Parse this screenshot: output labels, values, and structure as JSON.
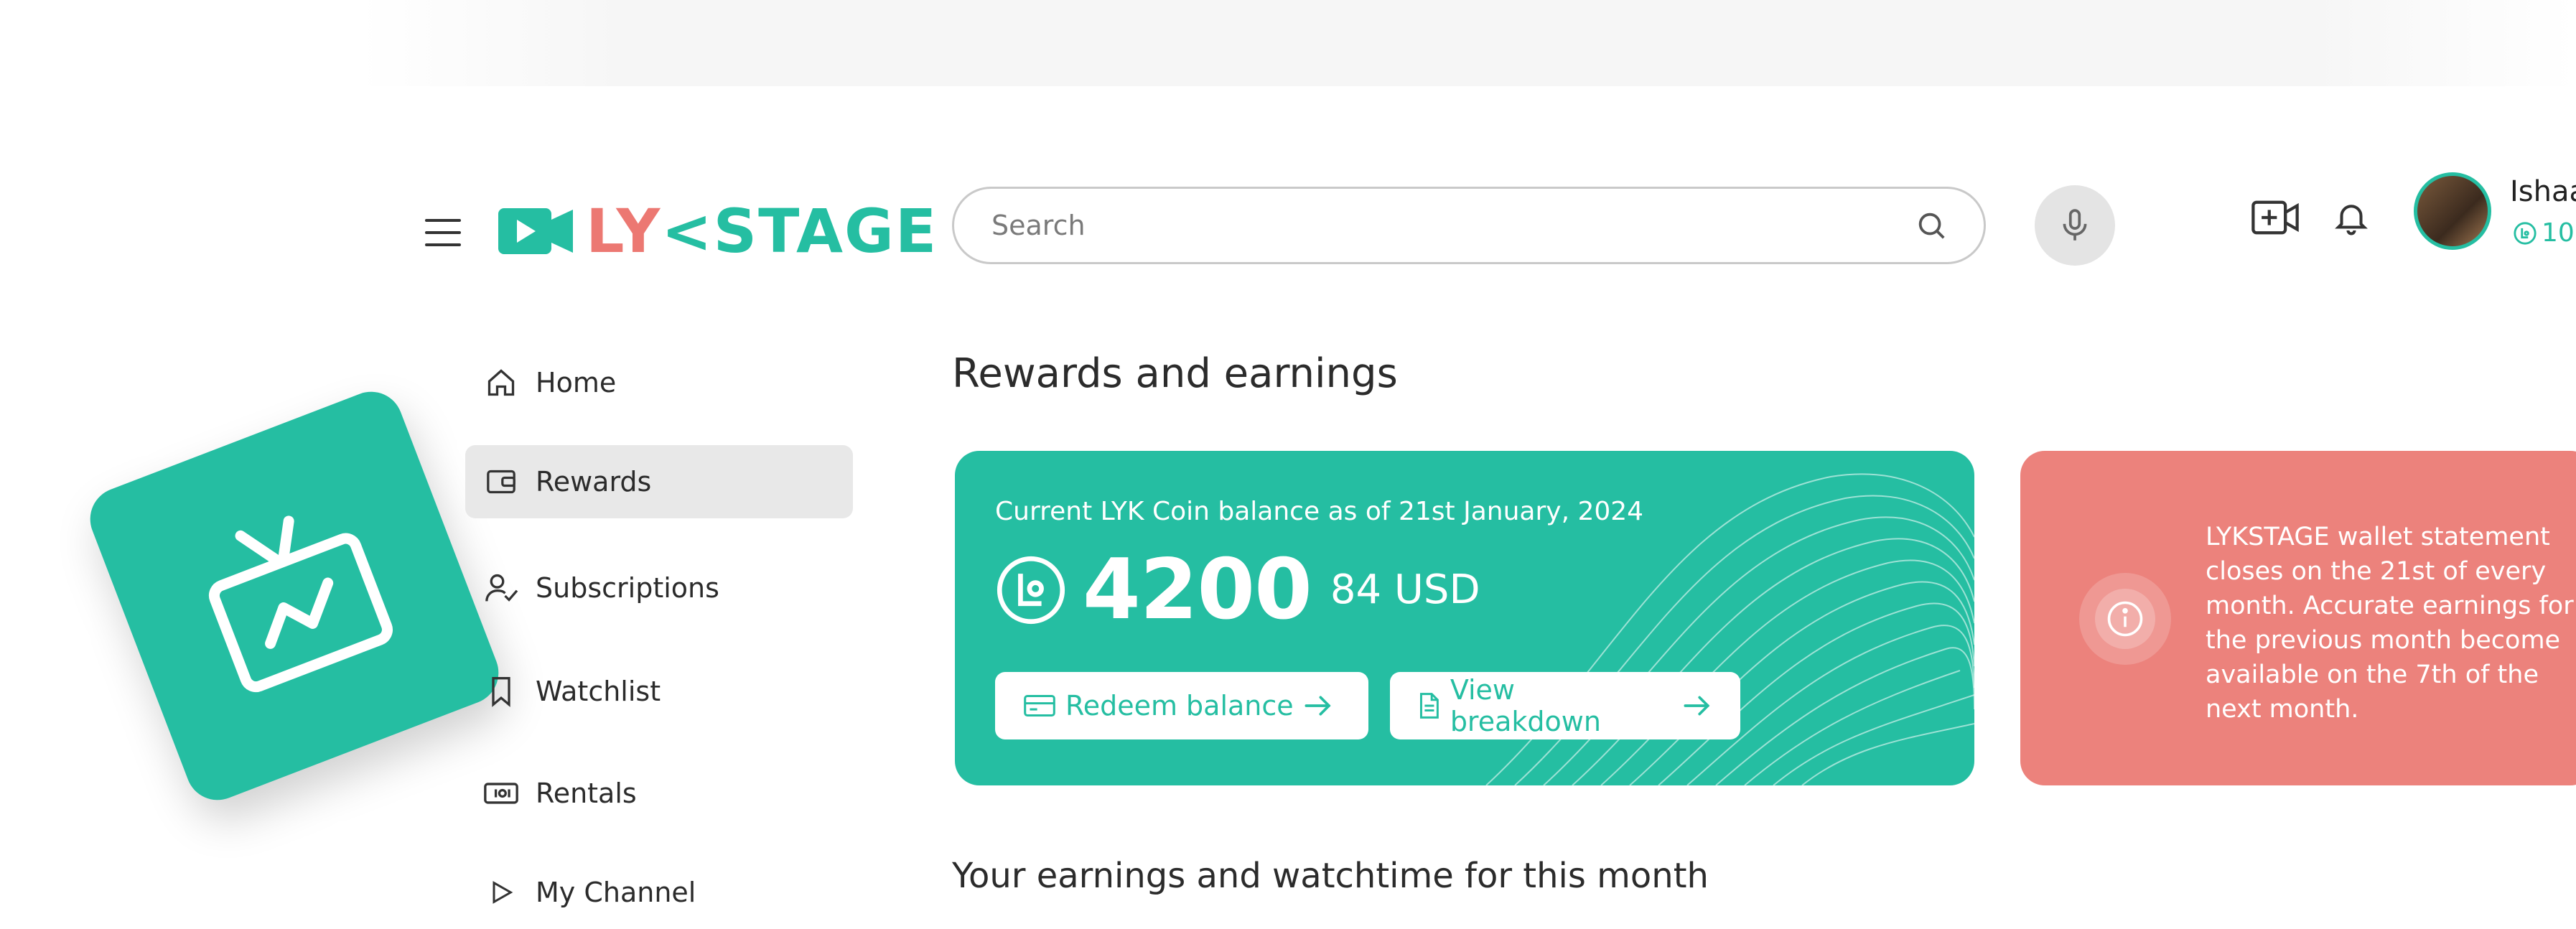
{
  "header": {
    "logo": {
      "text_part1": "LY",
      "text_part2": "STAGE"
    },
    "search": {
      "placeholder": "Search"
    },
    "user": {
      "name": "Ishaa",
      "coins": "10"
    }
  },
  "sidebar": {
    "items": [
      {
        "label": "Home",
        "icon": "home-icon",
        "active": false
      },
      {
        "label": "Rewards",
        "icon": "wallet-icon",
        "active": true
      },
      {
        "label": "Subscriptions",
        "icon": "user-check-icon",
        "active": false
      },
      {
        "label": "Watchlist",
        "icon": "bookmark-icon",
        "active": false
      },
      {
        "label": "Rentals",
        "icon": "ticket-icon",
        "active": false
      },
      {
        "label": "My Channel",
        "icon": "play-icon",
        "active": false
      }
    ]
  },
  "main": {
    "title": "Rewards and earnings",
    "balance_card": {
      "caption": "Current LYK Coin balance as of 21st January, 2024",
      "amount": "4200",
      "usd": "84 USD",
      "redeem_label": "Redeem balance",
      "breakdown_label": "View breakdown"
    },
    "notice": {
      "text": "LYKSTAGE wallet statement closes on the 21st of every month. Accurate earnings for the previous month become available on the 7th of the next month."
    },
    "section_title": "Your earnings and watchtime for this month"
  },
  "colors": {
    "brand_teal": "#25bea2",
    "brand_coral": "#ec7872",
    "notice_bg": "#ec827c"
  }
}
